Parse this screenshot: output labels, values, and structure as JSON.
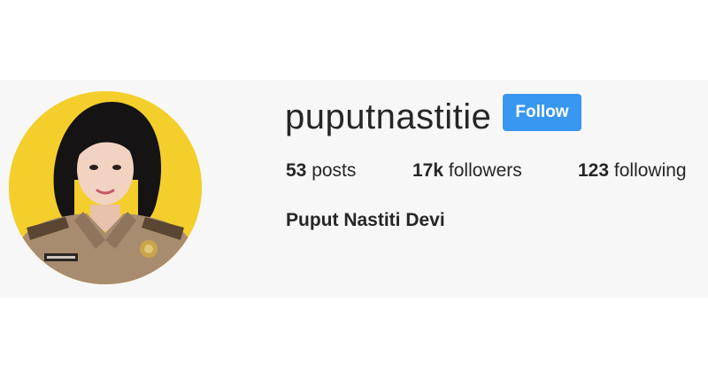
{
  "profile": {
    "username": "puputnastitie",
    "follow_label": "Follow",
    "full_name": "Puput Nastiti Devi",
    "avatar_description": "profile-photo"
  },
  "stats": {
    "posts": {
      "count": "53",
      "label": "posts"
    },
    "followers": {
      "count": "17k",
      "label": "followers"
    },
    "following": {
      "count": "123",
      "label": "following"
    }
  },
  "colors": {
    "follow_button": "#3897f0",
    "header_background": "#f7f7f7",
    "avatar_background": "#f4cf2b",
    "text": "#262626"
  }
}
